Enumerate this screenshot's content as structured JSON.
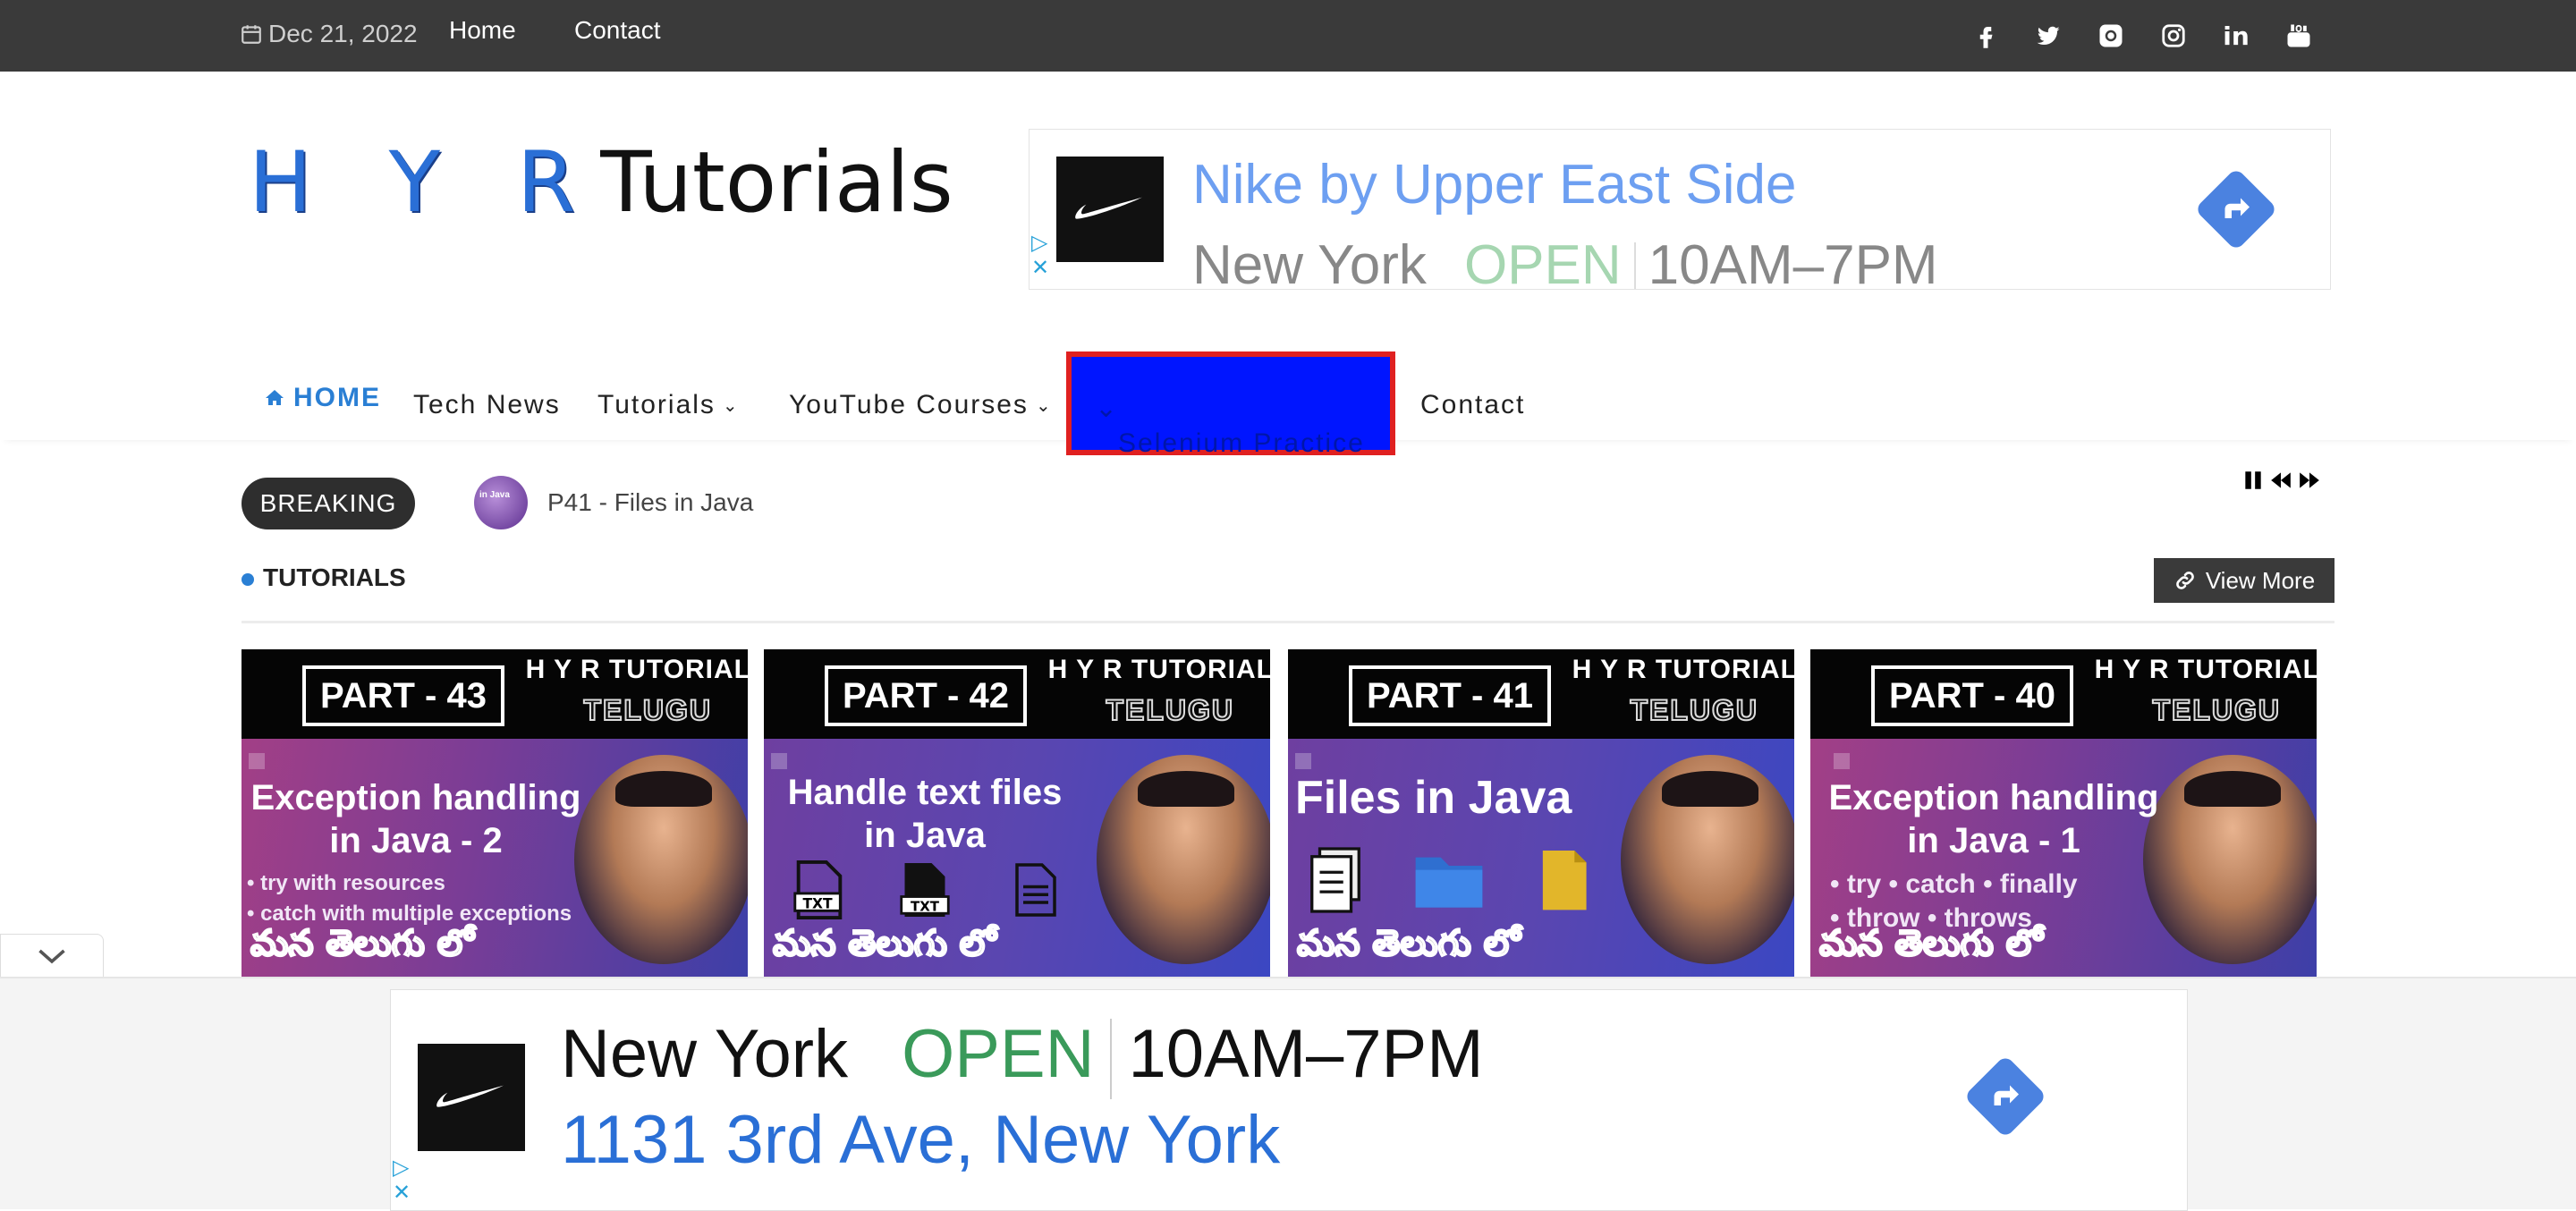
{
  "topbar": {
    "date": "Dec 21, 2022",
    "links": [
      "Home",
      "Contact"
    ],
    "social_icons": [
      "facebook-icon",
      "twitter-icon",
      "github-icon",
      "instagram-icon",
      "linkedin-icon",
      "youtube-icon"
    ]
  },
  "logo": {
    "part1": "H Y R",
    "part2": "Tutorials"
  },
  "ad_top": {
    "line1": "Nike by Upper East Side",
    "city": "New York",
    "status": "OPEN",
    "hours": "10AM–7PM"
  },
  "nav": {
    "home": "HOME",
    "items": [
      "Tech News",
      "Tutorials",
      "YouTube Courses",
      "Selenium Practice",
      "Contact"
    ]
  },
  "breaking": {
    "label": "BREAKING",
    "headline": "P41 - Files in Java",
    "thumb_text": "in Java"
  },
  "section": {
    "title": "TUTORIALS",
    "view_more": "View More"
  },
  "cards": [
    {
      "part": "PART - 43",
      "brand": "H Y R TUTORIAL",
      "tag": "TELUGU",
      "title_l1": "Exception handling",
      "title_l2": "in Java - 2",
      "bullet1": "• try with resources",
      "bullet2": "• catch with multiple exceptions",
      "footer": "మన తెలుగు లో"
    },
    {
      "part": "PART - 42",
      "brand": "H Y R TUTORIAL",
      "tag": "TELUGU",
      "title_l1": "Handle text files",
      "title_l2": "in Java",
      "doc_label": "TXT",
      "footer": "మన తెలుగు లో"
    },
    {
      "part": "PART - 41",
      "brand": "H Y R TUTORIAL",
      "tag": "TELUGU",
      "title_l1": "Files in Java",
      "footer": "మన తెలుగు లో"
    },
    {
      "part": "PART - 40",
      "brand": "H Y R TUTORIAL",
      "tag": "TELUGU",
      "title_l1": "Exception handling",
      "title_l2": "in Java - 1",
      "bullet1": "• try   • catch   • finally",
      "bullet2": "• throw   • throws",
      "footer": "మన తెలుగు లో"
    }
  ],
  "ad_bottom": {
    "city": "New York",
    "status": "OPEN",
    "hours": "10AM–7PM",
    "address": "1131 3rd Ave, New York"
  },
  "colors": {
    "accent": "#2a7fd4",
    "topbar": "#3a3a3a",
    "highlight_fill": "#0015ff",
    "highlight_border": "#e02020",
    "open_green": "#3a9a5a"
  }
}
